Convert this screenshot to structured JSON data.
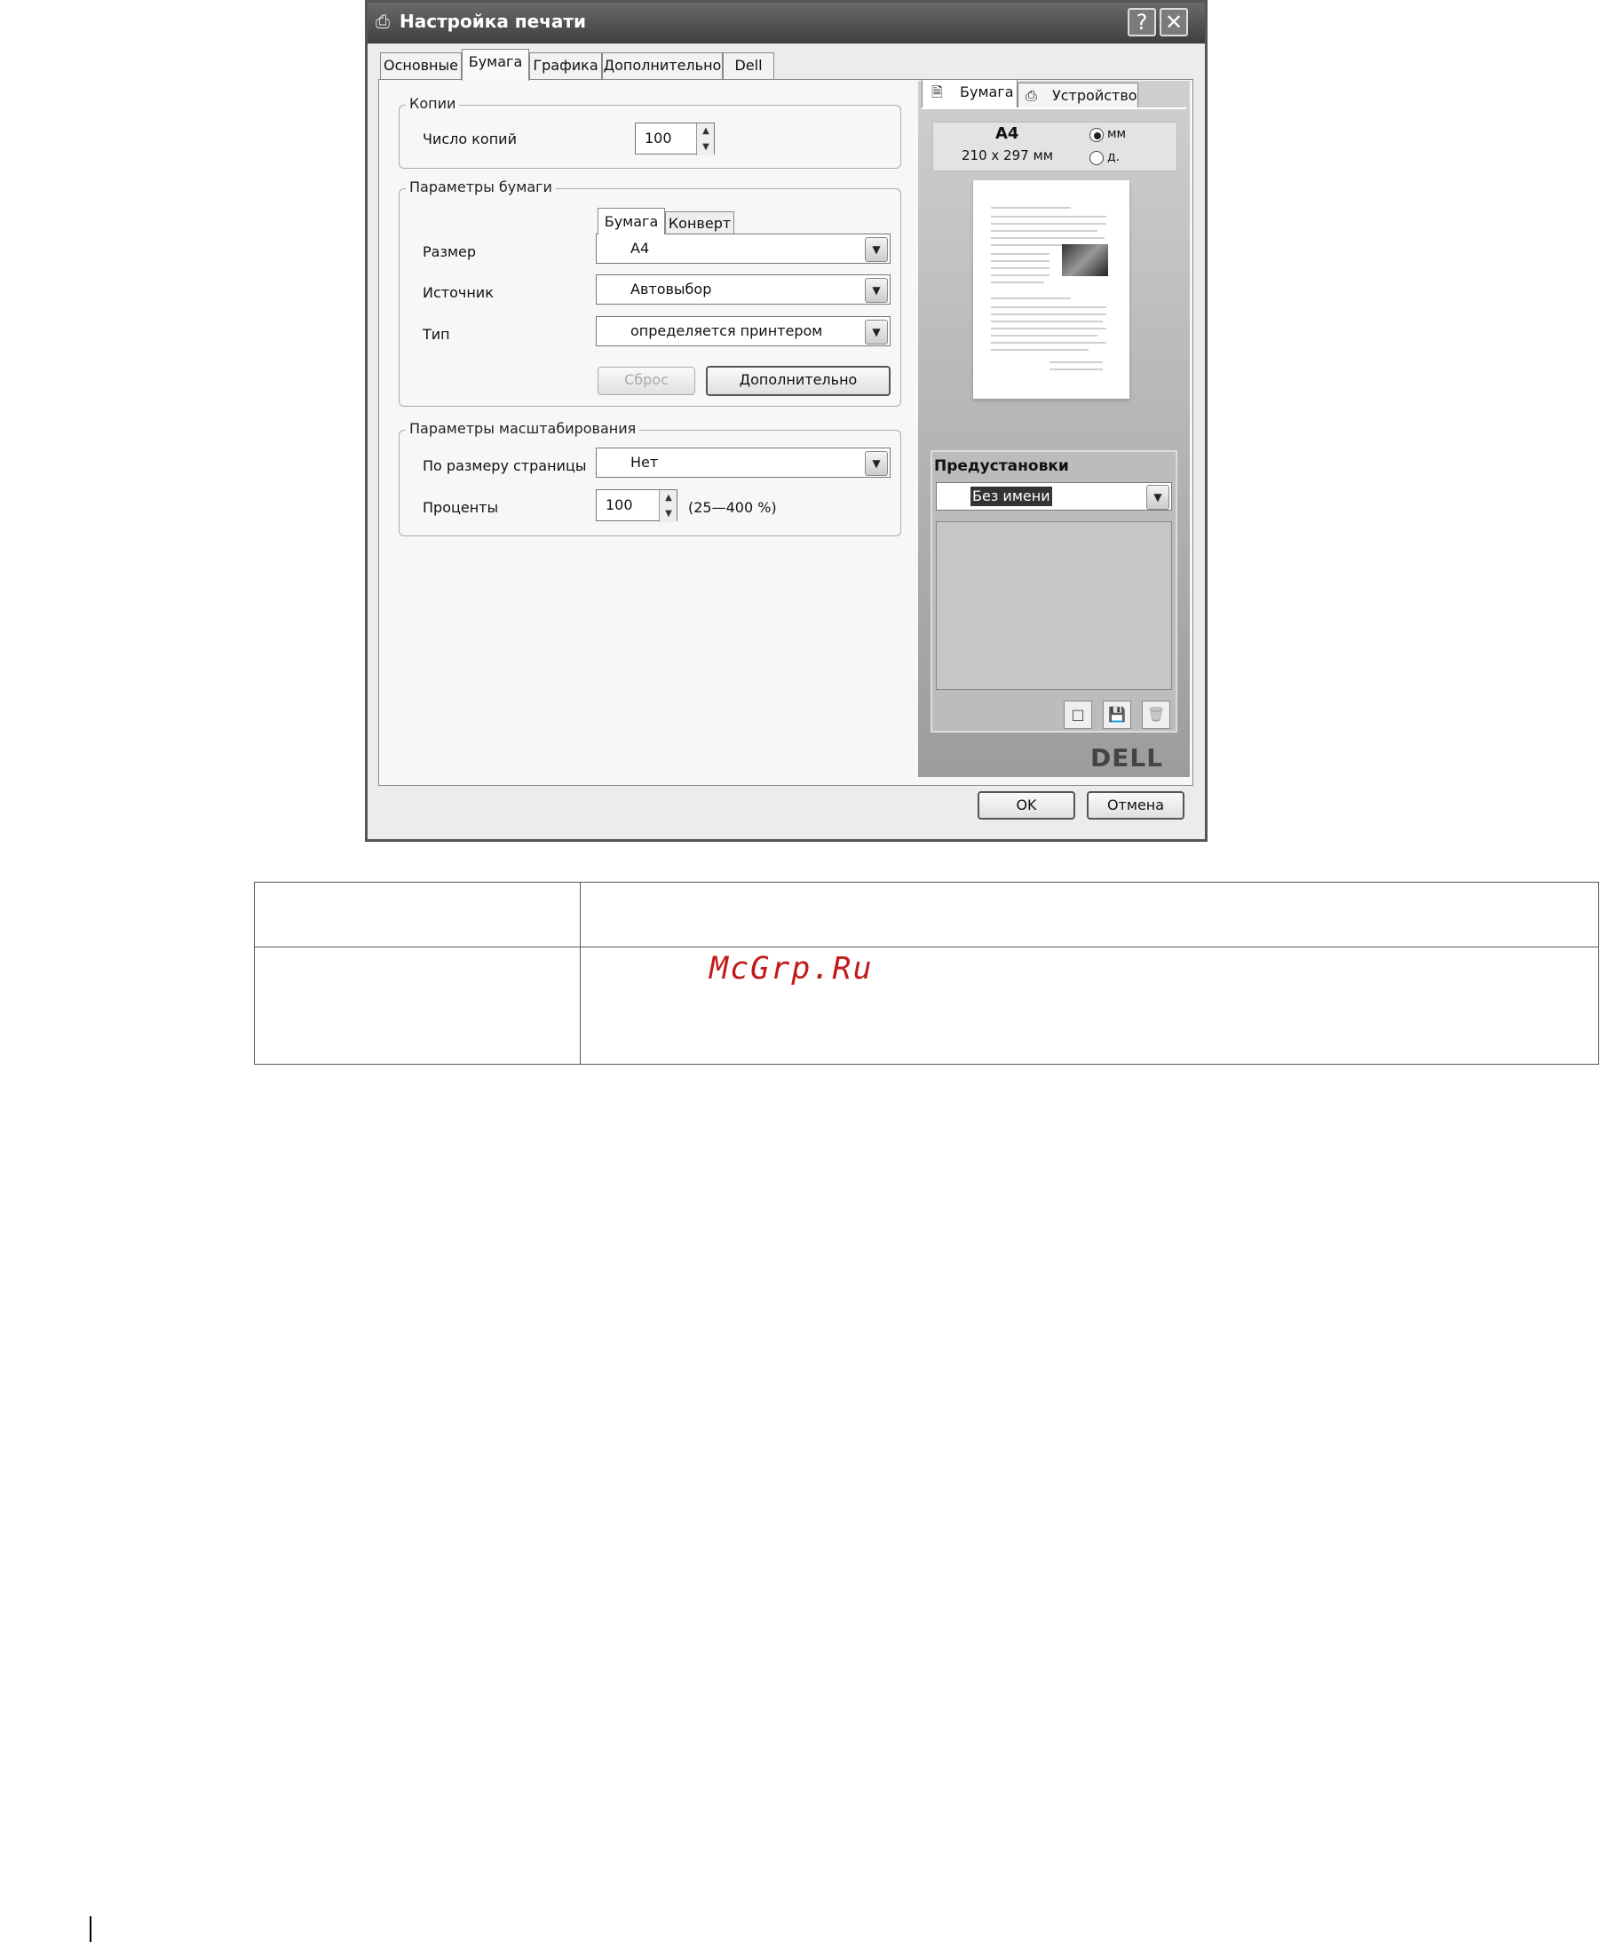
{
  "dialog": {
    "title": "Настройка печати",
    "help_label": "?",
    "close_label": "✕",
    "tabs": [
      "Основные",
      "Бумага",
      "Графика",
      "Дополнительно",
      "Dell"
    ],
    "active_tab": "Бумага"
  },
  "copies": {
    "legend": "Копии",
    "label": "Число копий",
    "value": "100"
  },
  "paper": {
    "legend": "Параметры бумаги",
    "subtabs": [
      "Бумага",
      "Конверт"
    ],
    "size_label": "Размер",
    "size_value": "A4",
    "source_label": "Источник",
    "source_value": "Автовыбор",
    "type_label": "Тип",
    "type_value": "определяется принтером",
    "reset_label": "Сброс",
    "advanced_label": "Дополнительно"
  },
  "scaling": {
    "legend": "Параметры масштабирования",
    "fit_label": "По размеру страницы",
    "fit_value": "Нет",
    "percent_label": "Проценты",
    "percent_value": "100",
    "percent_range": "(25—400 %)"
  },
  "preview": {
    "tabs": [
      "Бумага",
      "Устройство"
    ],
    "size_name": "A4",
    "size_dims": "210 x 297 мм",
    "unit_mm": "мм",
    "unit_in": "д.",
    "selected_unit": "мм"
  },
  "presets": {
    "title": "Предустановки",
    "value": "Без имени"
  },
  "brand": "DELL",
  "footer": {
    "ok_label": "OK",
    "cancel_label": "Отмена"
  },
  "watermark": "McGrp.Ru"
}
